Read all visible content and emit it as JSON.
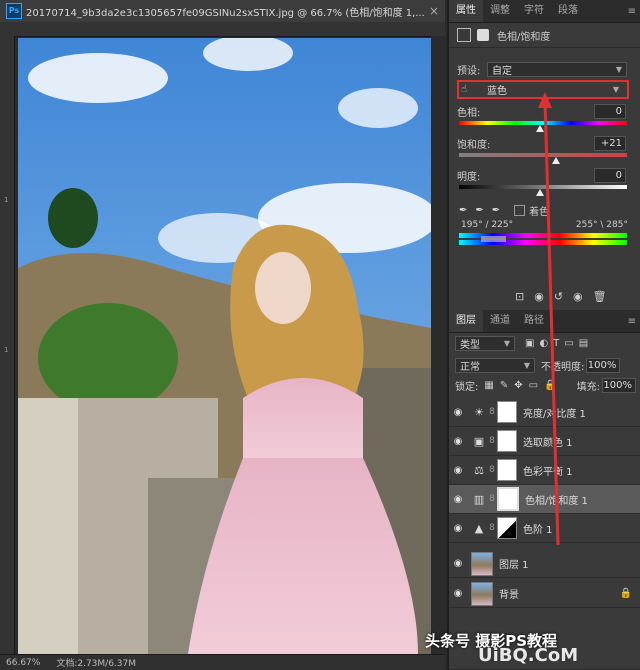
{
  "document": {
    "title": "20170714_9b3da2e3c1305657fe09GSINu2sxSTIX.jpg @ 66.7% (色相/饱和度 1,...",
    "app_icon": "Ps",
    "close": "×",
    "zoom": "66.67%",
    "doc_size": "文档:2.73M/6.37M",
    "ruler_marks": [
      "1",
      "1"
    ]
  },
  "properties_panel": {
    "tabs": [
      "属性",
      "调整",
      "字符",
      "段落"
    ],
    "active_tab": "属性",
    "title": "色相/饱和度",
    "preset_label": "预设:",
    "preset_value": "自定",
    "channel_value": "蓝色",
    "hue_label": "色相:",
    "hue_value": "0",
    "saturation_label": "饱和度:",
    "saturation_value": "+21",
    "lightness_label": "明度:",
    "lightness_value": "0",
    "colorize_label": "着色",
    "range_left": "195° / 225°",
    "range_right": "255° \\ 285°"
  },
  "layers_panel": {
    "tabs": [
      "图层",
      "通道",
      "路径"
    ],
    "filter_value": "类型",
    "blend_mode": "正常",
    "opacity_label": "不透明度:",
    "opacity_value": "100%",
    "lock_label": "锁定:",
    "fill_label": "填充:",
    "fill_value": "100%",
    "layers": [
      {
        "name": "亮度/对比度 1",
        "icon": "brightness-icon"
      },
      {
        "name": "选取颜色 1",
        "icon": "selective-color-icon"
      },
      {
        "name": "色彩平衡 1",
        "icon": "color-balance-icon"
      },
      {
        "name": "色相/饱和度 1",
        "icon": "hue-saturation-icon"
      },
      {
        "name": "色阶 1",
        "icon": "levels-icon"
      },
      {
        "name": "图层 1",
        "icon": "image-thumb"
      },
      {
        "name": "背景",
        "icon": "image-thumb"
      }
    ]
  },
  "watermark": {
    "line1": "头条号 摄影PS教程",
    "line2": "UiBQ.CoM"
  },
  "colors": {
    "highlight": "#e03030",
    "selected_layer": "#5a5a5a"
  }
}
